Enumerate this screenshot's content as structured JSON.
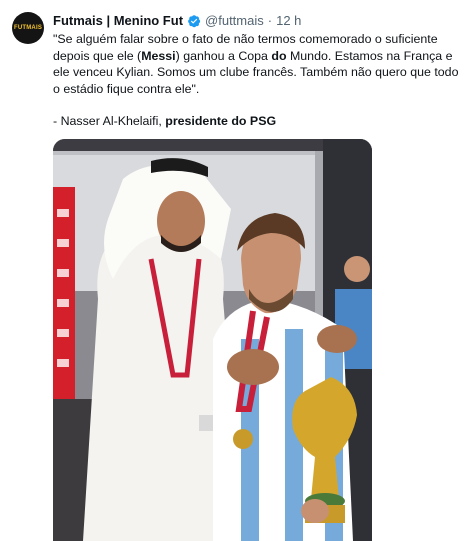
{
  "author": {
    "avatar_text": "FUTMAIS",
    "name": "Futmais | Menino Fut",
    "handle": "@futtmais",
    "separator": "·",
    "time": "12 h"
  },
  "tweet": {
    "quote_parts": [
      "\"Se alguém falar sobre o fato de não termos comemorado o suficiente depois que ele (",
      "Messi",
      ") ganhou a Copa ",
      "do",
      " Mundo. Estamos na França e ele venceu Kylian. Somos um clube francês. Também não quero que todo o estádio fique contra ele\"."
    ],
    "attribution_prefix": "- Nasser Al-Khelaifi, ",
    "attribution_bold": "presidente do PSG"
  },
  "icons": {
    "verified": "verified-badge-icon"
  },
  "colors": {
    "verified_blue": "#1d9bf0",
    "avatar_bg": "#141414",
    "avatar_text": "#f2c230"
  }
}
